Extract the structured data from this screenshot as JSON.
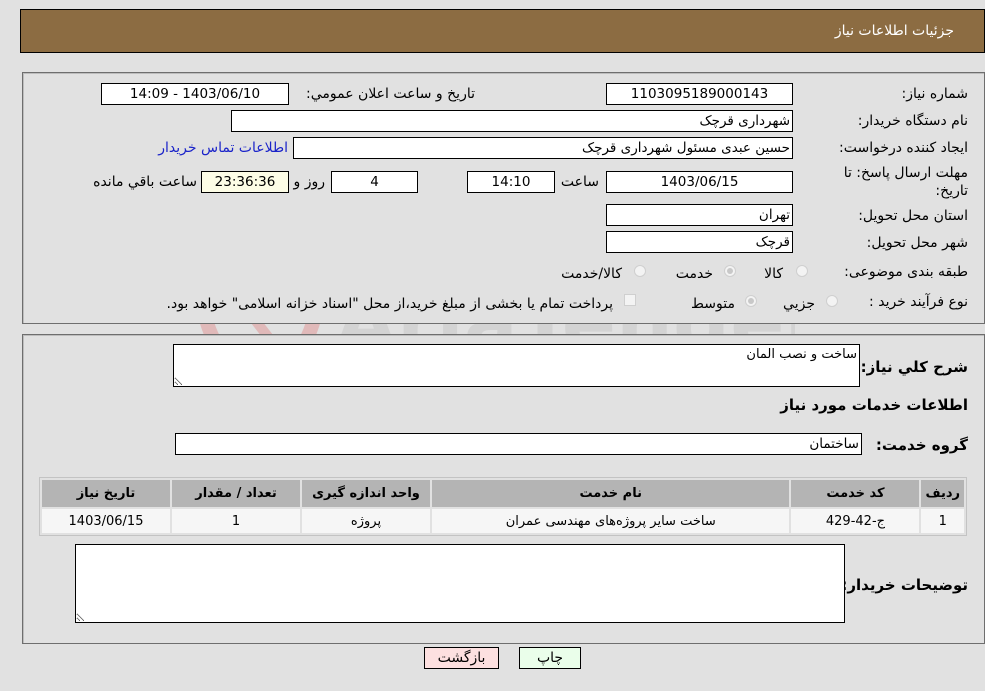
{
  "header": {
    "title": "جزئیات اطلاعات نیاز"
  },
  "form": {
    "need_number": {
      "label": "شماره نیاز:",
      "value": "1103095189000143"
    },
    "announce_datetime": {
      "label": "تاریخ و ساعت اعلان عمومي:",
      "value": "1403/06/10 - 14:09"
    },
    "buyer_org": {
      "label": "نام دستگاه خریدار:",
      "value": "شهرداری قرچک"
    },
    "requester": {
      "label": "ایجاد کننده درخواست:",
      "value": "حسین عبدی مسئول شهرداری قرچک"
    },
    "buyer_contact_link": "اطلاعات تماس خریدار",
    "deadline": {
      "label": "مهلت ارسال پاسخ: تا تاریخ:",
      "date": "1403/06/15",
      "time_label": "ساعت",
      "time": "14:10",
      "days": "4",
      "days_label": "روز و",
      "remaining": "23:36:36",
      "remaining_label": "ساعت باقي مانده"
    },
    "province": {
      "label": "استان محل تحویل:",
      "value": "تهران"
    },
    "city": {
      "label": "شهر محل تحویل:",
      "value": "قرچک"
    },
    "category": {
      "label": "طبقه بندی موضوعی:",
      "options": [
        "کالا",
        "خدمت",
        "کالا/خدمت"
      ],
      "selected": "خدمت"
    },
    "purchase_type": {
      "label": "نوع فرآیند خرید :",
      "options": [
        "جزیي",
        "متوسط"
      ],
      "selected": "متوسط",
      "treasury_note": "پرداخت تمام یا بخشی از مبلغ خرید،از محل \"اسناد خزانه اسلامی\" خواهد بود."
    }
  },
  "details": {
    "description": {
      "label": "شرح کلي نیاز:",
      "value": "ساخت و نصب المان"
    },
    "services_heading": "اطلاعات خدمات مورد نیاز",
    "service_group": {
      "label": "گروه خدمت:",
      "value": "ساختمان"
    },
    "table": {
      "headers": [
        "ردیف",
        "کد خدمت",
        "نام خدمت",
        "واحد اندازه گیری",
        "تعداد / مقدار",
        "تاریخ نیاز"
      ],
      "rows": [
        [
          "1",
          "ج-42-429",
          "ساخت سایر پروژه‌های مهندسی عمران",
          "پروژه",
          "1",
          "1403/06/15"
        ]
      ]
    },
    "buyer_notes": {
      "label": "توضیحات خریدار:",
      "value": ""
    }
  },
  "buttons": {
    "print": "چاپ",
    "back": "بازگشت"
  },
  "watermark": {
    "text": "AriaTender.neT"
  },
  "colors": {
    "header_bg": "#8c6c42",
    "print_button_bg": "#eafeea",
    "back_button_bg": "#fde0e0",
    "link": "#1a23c9",
    "remaining_bg": "#fdfde6"
  }
}
